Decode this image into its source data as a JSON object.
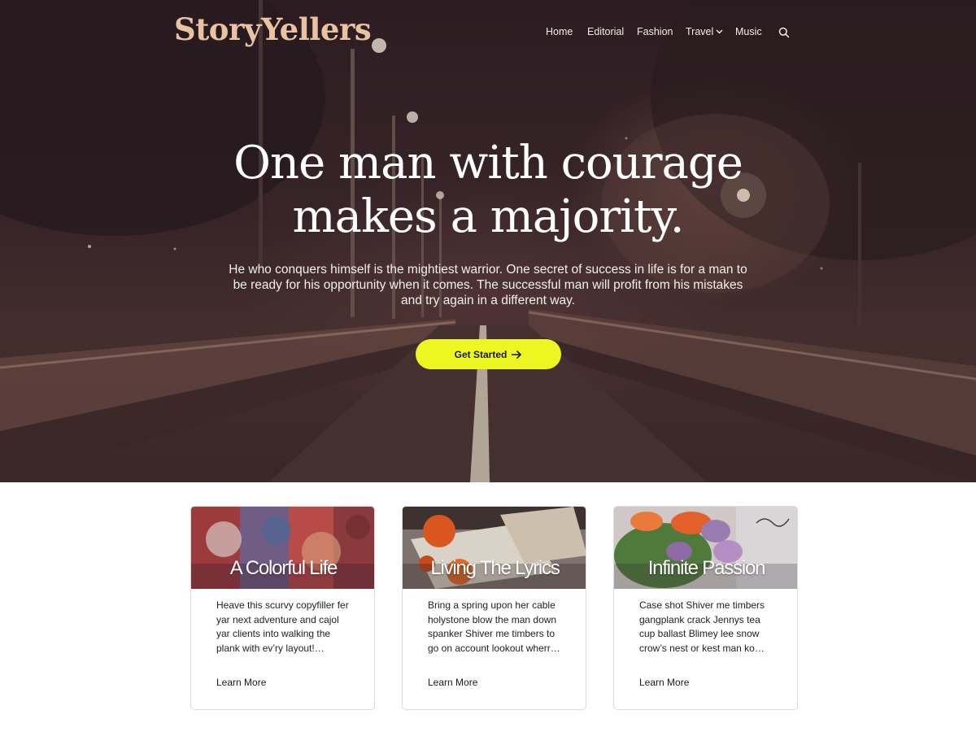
{
  "header": {
    "brand": "StoryYellers",
    "nav": [
      {
        "label": "Home"
      },
      {
        "label": "Editorial"
      },
      {
        "label": "Fashion"
      },
      {
        "label": "Travel",
        "has_dropdown": true
      },
      {
        "label": "Music"
      }
    ],
    "search_icon": "search-icon"
  },
  "hero": {
    "title_line1": "One man with courage",
    "title_line2": "makes a majority.",
    "subtitle": "He who conquers himself is the mightiest warrior. One secret of success in life is for a man to be ready for his opportunity when it comes. The successful man will profit from his mistakes and try again in a different way.",
    "cta_label": "Get Started",
    "cta_icon": "arrow-right-icon",
    "cta_color": "#eef622",
    "brand_color": "#e9c2a2"
  },
  "cards": [
    {
      "title": "A Colorful Life",
      "text": "Heave this scurvy copyfiller fer yar next adventure and cajol yar clients into walking the plank with ev’ry layout!…",
      "link": "Learn More"
    },
    {
      "title": "Living The Lyrics",
      "text": "Bring a spring upon her cable holystone blow the man down spanker Shiver me timbers to go on account lookout wherr…",
      "link": "Learn More"
    },
    {
      "title": "Infinite Passion",
      "text": "Case shot Shiver me timbers gangplank crack Jennys tea cup ballast Blimey lee snow crow’s nest or kest man ko…",
      "link": "Learn More"
    }
  ]
}
